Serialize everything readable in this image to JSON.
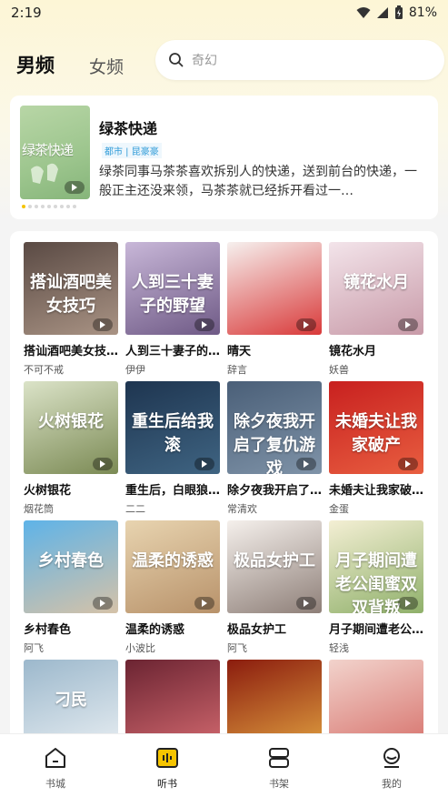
{
  "status": {
    "time": "2:19",
    "battery": "81%"
  },
  "tabs": [
    {
      "label": "男频",
      "active": true
    },
    {
      "label": "女频",
      "active": false
    }
  ],
  "search": {
    "placeholder": "奇幻"
  },
  "featured": {
    "cover_text": "绿茶快递",
    "title": "绿茶快递",
    "tags": "都市 | 昆豪豪",
    "description": "绿茶同事马茶茶喜欢拆别人的快递，送到前台的快递，一般正主还没来领，马茶茶就已经拆开看过一…",
    "carousel_total": 9,
    "carousel_index": 0
  },
  "books": [
    {
      "title": "搭讪酒吧美女技…",
      "author": "不可不戒",
      "cover_text": "搭讪酒吧美女技巧",
      "cover_colors": [
        "#5a4a44",
        "#a99384"
      ]
    },
    {
      "title": "人到三十妻子的…",
      "author": "伊伊",
      "cover_text": "人到三十妻子的野望",
      "cover_colors": [
        "#c8b7d8",
        "#6f5a86"
      ]
    },
    {
      "title": "晴天",
      "author": "辞言",
      "cover_text": "",
      "cover_colors": [
        "#f6f0ee",
        "#d93a3a"
      ]
    },
    {
      "title": "镜花水月",
      "author": "妖兽",
      "cover_text": "镜花水月",
      "cover_colors": [
        "#f3e4ea",
        "#c89aa8"
      ]
    },
    {
      "title": "火树银花",
      "author": "烟花筒",
      "cover_text": "火树银花",
      "cover_colors": [
        "#dbe3c8",
        "#7b8a54"
      ]
    },
    {
      "title": "重生后，白眼狼…",
      "author": "二二",
      "cover_text": "重生后给我滚",
      "cover_colors": [
        "#1e3550",
        "#3f6482"
      ]
    },
    {
      "title": "除夕夜我开启了…",
      "author": "常清欢",
      "cover_text": "除夕夜我开启了复仇游戏",
      "cover_colors": [
        "#4a5f78",
        "#7f93a8"
      ]
    },
    {
      "title": "未婚夫让我家破…",
      "author": "金蛋",
      "cover_text": "未婚夫让我家破产",
      "cover_colors": [
        "#c8201f",
        "#e85e40"
      ]
    },
    {
      "title": "乡村春色",
      "author": "阿飞",
      "cover_text": "乡村春色",
      "cover_colors": [
        "#5eb3e8",
        "#d5c2a8"
      ]
    },
    {
      "title": "温柔的诱惑",
      "author": "小波比",
      "cover_text": "温柔的诱惑",
      "cover_colors": [
        "#e8d4b0",
        "#b8926a"
      ]
    },
    {
      "title": "极品女护工",
      "author": "阿飞",
      "cover_text": "极品女护工",
      "cover_colors": [
        "#f5f0ec",
        "#8e7f78"
      ]
    },
    {
      "title": "月子期间遭老公…",
      "author": "轻浅",
      "cover_text": "月子期间遭老公闺蜜双双背叛",
      "cover_colors": [
        "#f4efd4",
        "#8fb06a"
      ]
    },
    {
      "title": "",
      "author": "",
      "cover_text": "刁民",
      "cover_colors": [
        "#9cb8cc",
        "#e8eef2"
      ]
    },
    {
      "title": "",
      "author": "",
      "cover_text": "",
      "cover_colors": [
        "#6b2432",
        "#d46a70"
      ]
    },
    {
      "title": "",
      "author": "",
      "cover_text": "",
      "cover_colors": [
        "#8b1c0e",
        "#e0a040"
      ]
    },
    {
      "title": "",
      "author": "",
      "cover_text": "",
      "cover_colors": [
        "#f2d3cc",
        "#d6706a"
      ]
    }
  ],
  "bottom_nav": [
    {
      "label": "书城",
      "icon": "home-icon",
      "active": false
    },
    {
      "label": "听书",
      "icon": "audio-book-icon",
      "active": true
    },
    {
      "label": "书架",
      "icon": "bookshelf-icon",
      "active": false
    },
    {
      "label": "我的",
      "icon": "profile-icon",
      "active": false
    }
  ],
  "colors": {
    "accent": "#f5c400",
    "tag_blue": "#2f9bd8"
  }
}
